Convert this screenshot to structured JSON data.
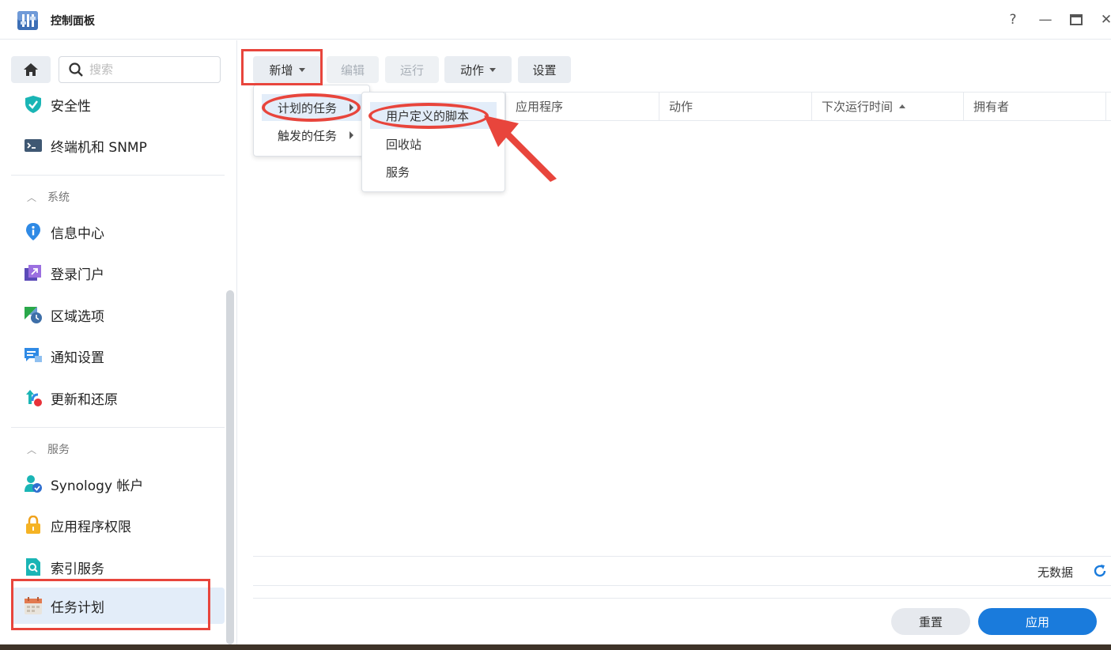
{
  "window": {
    "title": "控制面板",
    "help": "?",
    "minimize": "—",
    "close": "✕"
  },
  "sidebar": {
    "search_placeholder": "搜索",
    "items_top": [
      {
        "label": "安全性"
      },
      {
        "label": "终端机和 SNMP"
      }
    ],
    "section_system": "系统",
    "items_system": [
      {
        "label": "信息中心"
      },
      {
        "label": "登录门户"
      },
      {
        "label": "区域选项"
      },
      {
        "label": "通知设置"
      },
      {
        "label": "更新和还原"
      }
    ],
    "section_services": "服务",
    "items_services": [
      {
        "label": "Synology 帐户"
      },
      {
        "label": "应用程序权限"
      },
      {
        "label": "索引服务"
      },
      {
        "label": "任务计划"
      }
    ]
  },
  "toolbar": {
    "create": "新增",
    "edit": "编辑",
    "run": "运行",
    "action": "动作",
    "settings": "设置"
  },
  "grid": {
    "columns": [
      "应用程序",
      "动作",
      "下次运行时间",
      "拥有者"
    ]
  },
  "menu_create": {
    "items": [
      "计划的任务",
      "触发的任务"
    ]
  },
  "menu_scheduled": {
    "items": [
      "用户定义的脚本",
      "回收站",
      "服务"
    ]
  },
  "status": {
    "no_data": "无数据"
  },
  "footer": {
    "reset": "重置",
    "apply": "应用"
  },
  "colors": {
    "accent": "#1a7bdc",
    "annotation": "#e8453c",
    "active_bg": "#e3edf9"
  }
}
